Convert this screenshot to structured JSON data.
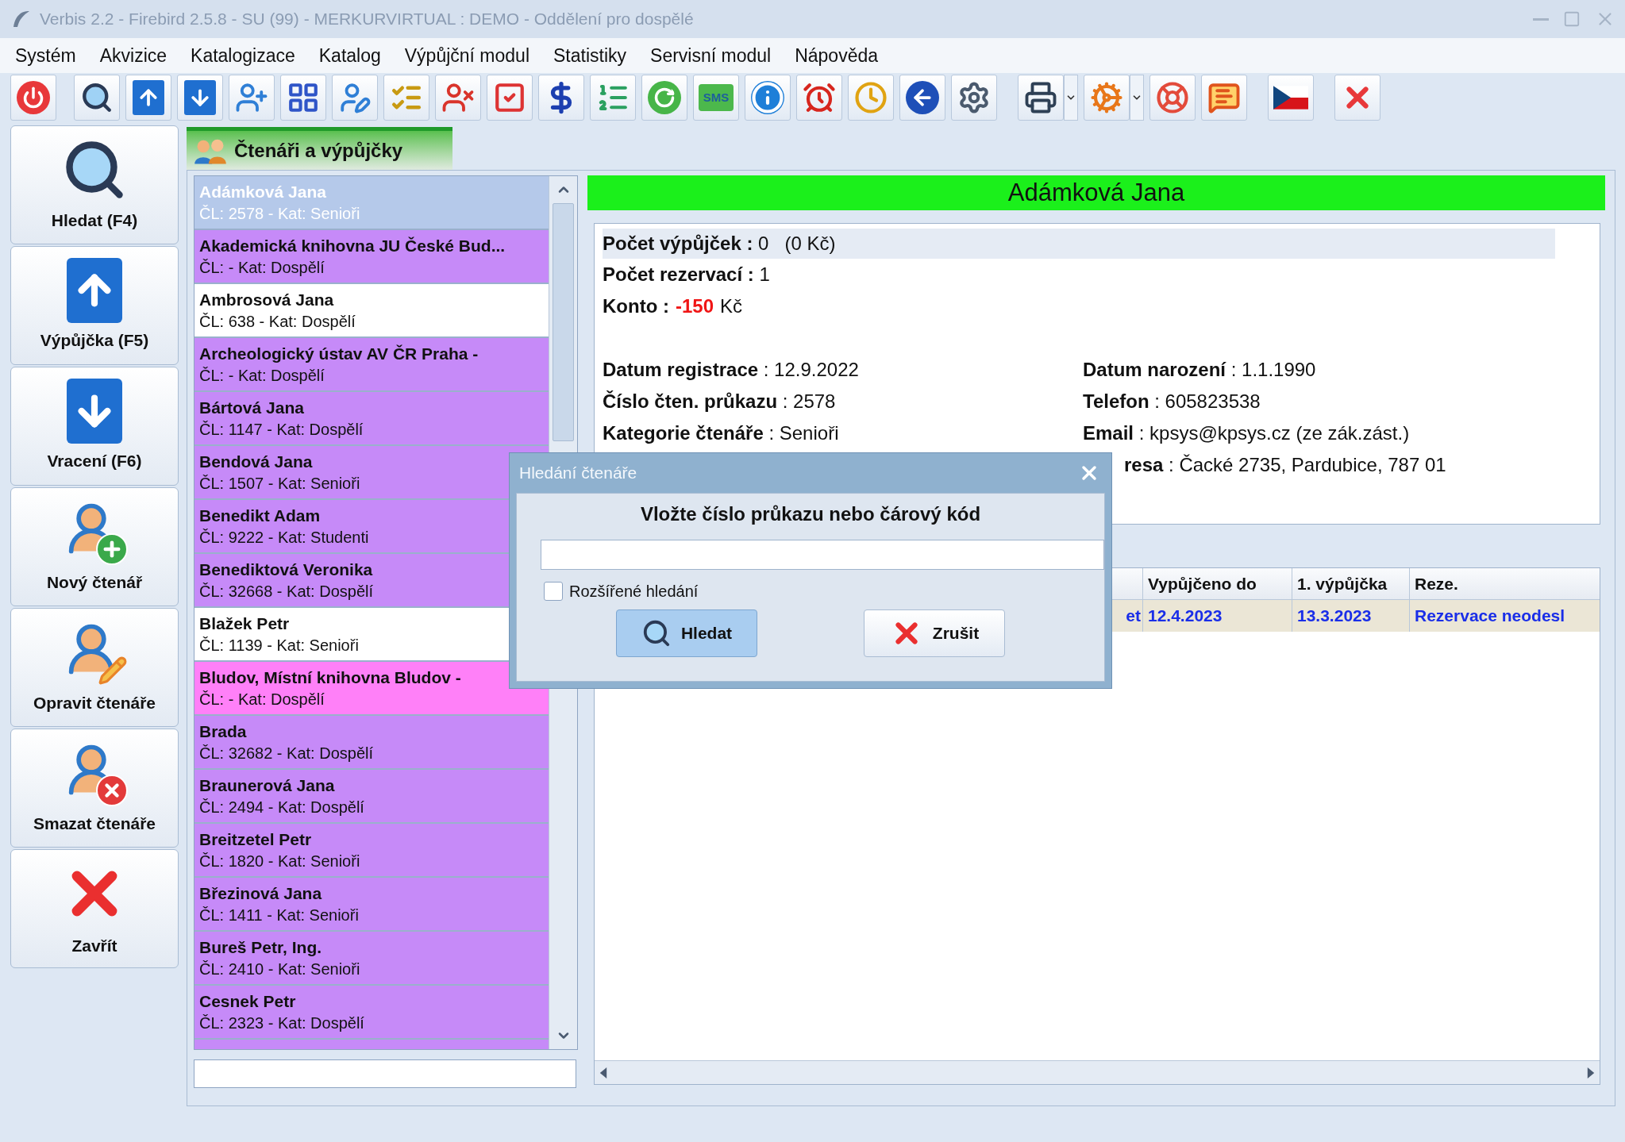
{
  "window": {
    "title": "Verbis 2.2 - Firebird 2.5.8 - SU (99) - MERKURVIRTUAL : DEMO - Oddělení pro dospělé"
  },
  "menu": [
    "Systém",
    "Akvizice",
    "Katalogizace",
    "Katalog",
    "Výpůjční modul",
    "Statistiky",
    "Servisní modul",
    "Nápověda"
  ],
  "toolbar": {
    "sms_label": "SMS"
  },
  "nav_buttons": [
    {
      "label": "Hledat (F4)",
      "kind": "search"
    },
    {
      "label": "Výpůjčka (F5)",
      "kind": "loan"
    },
    {
      "label": "Vracení (F6)",
      "kind": "return"
    },
    {
      "label": "Nový čtenář",
      "kind": "add-reader"
    },
    {
      "label": "Opravit čtenáře",
      "kind": "edit-reader"
    },
    {
      "label": "Smazat čtenáře",
      "kind": "delete-reader"
    },
    {
      "label": "Zavřít",
      "kind": "close"
    }
  ],
  "tab": {
    "label": "Čtenáři a výpůjčky",
    "selected": true
  },
  "readers": [
    {
      "name": "Adámková Jana",
      "detail": "ČL: 2578 - Kat: Senioři",
      "color": "#b5c9ea",
      "selected": true
    },
    {
      "name": "Akademická knihovna JU České Bud...",
      "detail": "ČL:  - Kat: Dospělí",
      "color": "#c68af8",
      "selected": false
    },
    {
      "name": "Ambrosová Jana",
      "detail": "ČL: 638 - Kat: Dospělí",
      "color": "#ffffff",
      "selected": false
    },
    {
      "name": "Archeologický ústav AV ČR Praha -",
      "detail": "ČL:  - Kat: Dospělí",
      "color": "#c68af8",
      "selected": false
    },
    {
      "name": "Bártová Jana",
      "detail": "ČL: 1147 - Kat: Dospělí",
      "color": "#c68af8",
      "selected": false
    },
    {
      "name": "Bendová Jana",
      "detail": "ČL: 1507 - Kat: Senioři",
      "color": "#c68af8",
      "selected": false
    },
    {
      "name": "Benedikt Adam",
      "detail": "ČL: 9222 - Kat: Studenti",
      "color": "#c68af8",
      "selected": false
    },
    {
      "name": "Benediktová Veronika",
      "detail": "ČL: 32668 - Kat: Dospělí",
      "color": "#c68af8",
      "selected": false
    },
    {
      "name": "Blažek Petr",
      "detail": "ČL: 1139 - Kat: Senioři",
      "color": "#ffffff",
      "selected": false
    },
    {
      "name": "Bludov, Místní knihovna Bludov -",
      "detail": "ČL:  - Kat: Dospělí",
      "color": "#ff80f8",
      "selected": false
    },
    {
      "name": "Brada",
      "detail": "ČL: 32682 - Kat: Dospělí",
      "color": "#c68af8",
      "selected": false
    },
    {
      "name": "Braunerová Jana",
      "detail": "ČL: 2494 - Kat: Dospělí",
      "color": "#c68af8",
      "selected": false
    },
    {
      "name": "Breitzetel Petr",
      "detail": "ČL: 1820 - Kat: Senioři",
      "color": "#c68af8",
      "selected": false
    },
    {
      "name": "Březinová Jana",
      "detail": "ČL: 1411 - Kat: Senioři",
      "color": "#c68af8",
      "selected": false
    },
    {
      "name": "Bureš Petr, Ing.",
      "detail": "ČL: 2410 - Kat: Senioři",
      "color": "#c68af8",
      "selected": false
    },
    {
      "name": "Cesnek Petr",
      "detail": "ČL: 2323 - Kat: Dospělí",
      "color": "#c68af8",
      "selected": false
    }
  ],
  "reader": {
    "name": "Adámková Jana",
    "loans": "**Počet výpůjček :** 0   (0 Kč)",
    "reservations": "**Počet rezervací :** 1",
    "account": {
      "label": "Konto :",
      "amount": "-150",
      "currency": "Kč"
    },
    "details_left": [
      "**Datum registrace** : 12.9.2022",
      "**Číslo čten. průkazu** : 2578",
      "**Kategorie čtenáře** : Senioři"
    ],
    "details_right": [
      "**Datum narození** : 1.1.1990",
      "**Telefon** : 605823538",
      "**Email** : kpsys@kpsys.cz (ze zák.zást.)",
      "**resa** : Čacké 2735, Pardubice, 787 01"
    ]
  },
  "loans_table": {
    "columns": [
      "Vypůjčeno do",
      "1. výpůjčka",
      "Reze."
    ],
    "rows": [
      {
        "column_1": "et",
        "cells": [
          "12.4.2023",
          "13.3.2023",
          "Rezervace neodesl"
        ]
      }
    ]
  },
  "dialog": {
    "title": "Hledání čtenáře",
    "prompt": "Vložte číslo průkazu nebo čárový kód",
    "checkbox": {
      "label": "Rozšířené hledání",
      "checked": false
    },
    "buttons": [
      {
        "label": "Hledat",
        "kind": "search",
        "focused": true
      },
      {
        "label": "Zrušit",
        "kind": "cancel",
        "focused": false
      }
    ]
  }
}
